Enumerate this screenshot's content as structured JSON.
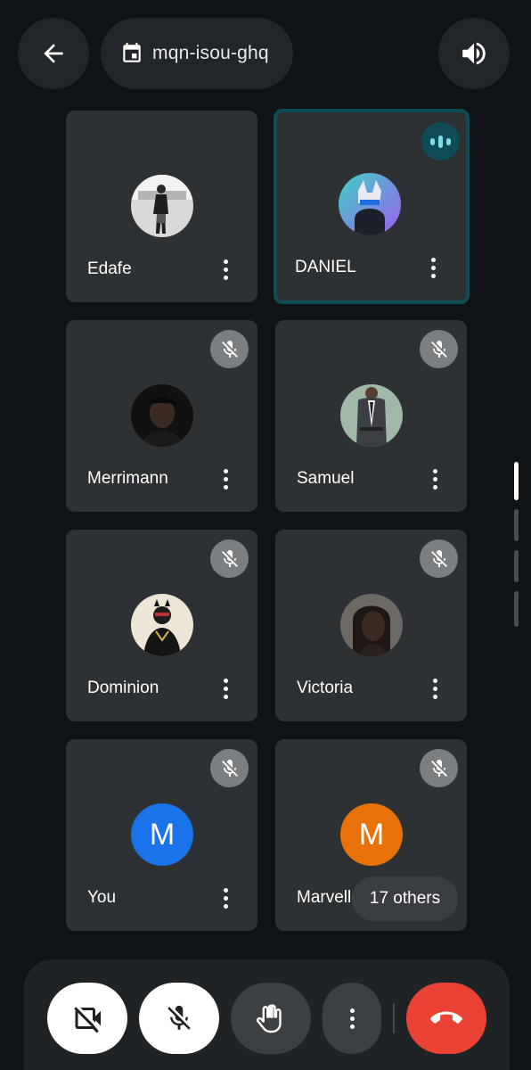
{
  "header": {
    "meeting_code": "mqn-isou-ghq",
    "icons": {
      "back": "arrow-left-icon",
      "calendar": "calendar-icon",
      "speaker": "volume-up-icon"
    }
  },
  "participants": [
    {
      "name": "Edafe",
      "avatar": "photo",
      "muted": false,
      "speaking": false
    },
    {
      "name": "DANIEL",
      "avatar": "photo",
      "muted": false,
      "speaking": true
    },
    {
      "name": "Merrimann",
      "avatar": "photo",
      "muted": true,
      "speaking": false
    },
    {
      "name": "Samuel",
      "avatar": "photo",
      "muted": true,
      "speaking": false
    },
    {
      "name": "Dominion",
      "avatar": "photo",
      "muted": true,
      "speaking": false
    },
    {
      "name": "Victoria",
      "avatar": "photo",
      "muted": true,
      "speaking": false
    },
    {
      "name": "You",
      "avatar": "M",
      "avatar_color": "#1a73e8",
      "muted": true,
      "speaking": false
    },
    {
      "name": "Marvellous",
      "avatar": "M",
      "avatar_color": "#e8710a",
      "muted": true,
      "speaking": false
    }
  ],
  "others_chip": "17 others",
  "controls": {
    "camera": "camera-off-icon",
    "mic": "mic-off-icon",
    "raise_hand": "raise-hand-icon",
    "more": "more-vertical-icon",
    "end_call": "call-end-icon"
  },
  "colors": {
    "background": "#101316",
    "tile": "#2d3134",
    "active_border": "#0e4d55",
    "end_call": "#ea4335"
  }
}
